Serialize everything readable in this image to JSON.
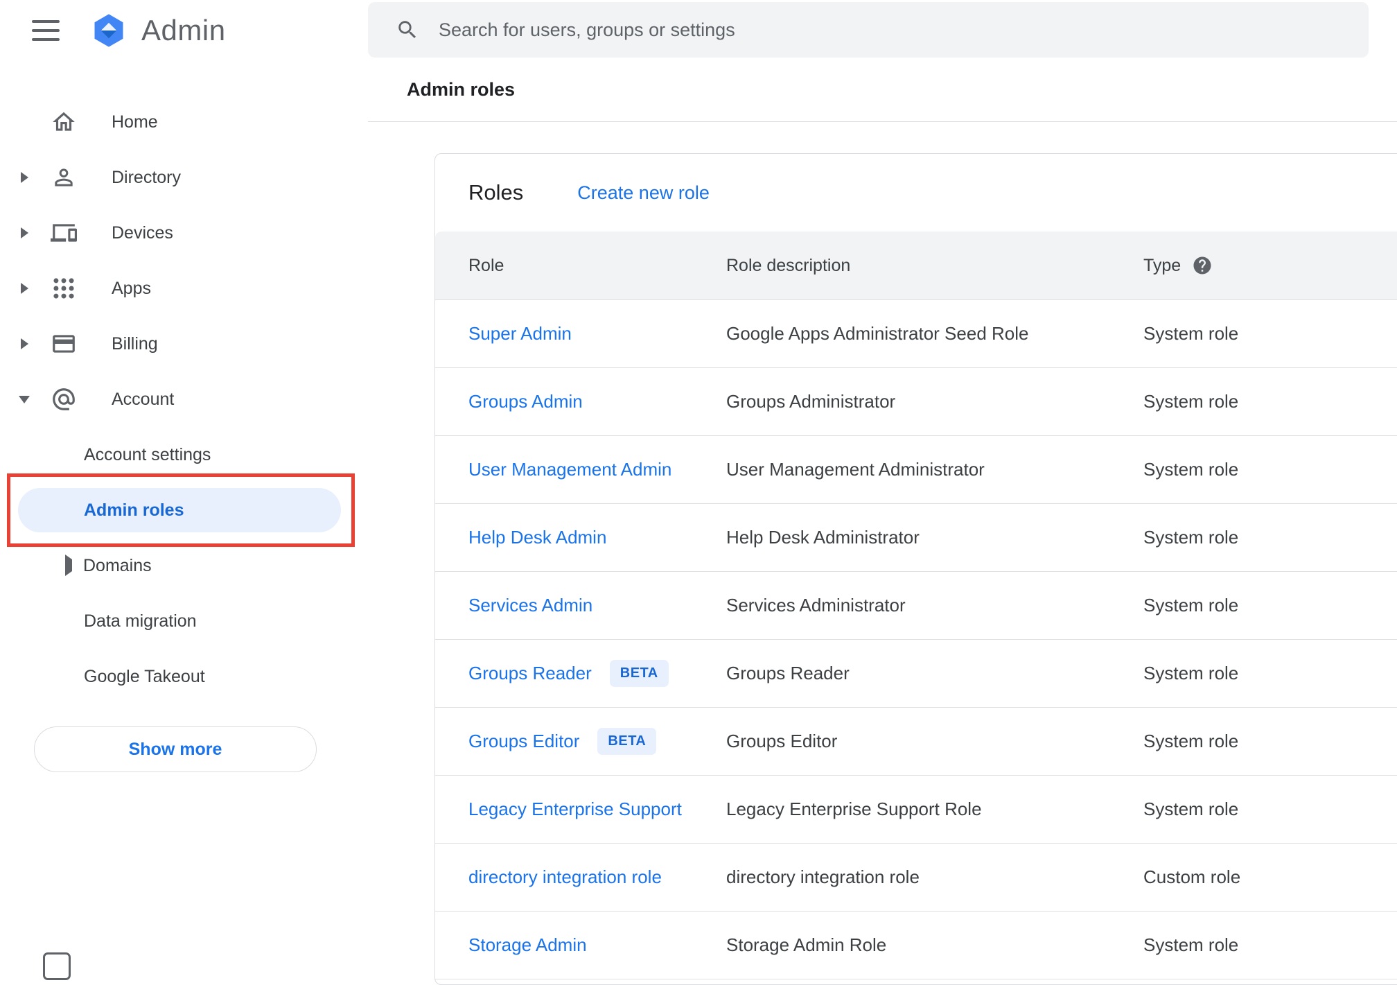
{
  "brand": {
    "name": "Admin"
  },
  "search": {
    "placeholder": "Search for users, groups or settings"
  },
  "page": {
    "title": "Admin roles"
  },
  "sidebar": {
    "items": [
      {
        "label": "Home"
      },
      {
        "label": "Directory"
      },
      {
        "label": "Devices"
      },
      {
        "label": "Apps"
      },
      {
        "label": "Billing"
      },
      {
        "label": "Account"
      }
    ],
    "account_children": {
      "settings": "Account settings",
      "admin_roles": "Admin roles",
      "domains": "Domains",
      "data_migration": "Data migration",
      "takeout": "Google Takeout"
    },
    "show_more_label": "Show more"
  },
  "roles": {
    "heading": "Roles",
    "create_link": "Create new role",
    "beta_label": "BETA",
    "columns": [
      "Role",
      "Role description",
      "Type"
    ],
    "rows": [
      {
        "role": "Super Admin",
        "beta": false,
        "description": "Google Apps Administrator Seed Role",
        "type": "System role"
      },
      {
        "role": "Groups Admin",
        "beta": false,
        "description": "Groups Administrator",
        "type": "System role"
      },
      {
        "role": "User Management Admin",
        "beta": false,
        "description": "User Management Administrator",
        "type": "System role"
      },
      {
        "role": "Help Desk Admin",
        "beta": false,
        "description": "Help Desk Administrator",
        "type": "System role"
      },
      {
        "role": "Services Admin",
        "beta": false,
        "description": "Services Administrator",
        "type": "System role"
      },
      {
        "role": "Groups Reader",
        "beta": true,
        "description": "Groups Reader",
        "type": "System role"
      },
      {
        "role": "Groups Editor",
        "beta": true,
        "description": "Groups Editor",
        "type": "System role"
      },
      {
        "role": "Legacy Enterprise Support",
        "beta": false,
        "description": "Legacy Enterprise Support Role",
        "type": "System role"
      },
      {
        "role": "directory integration role",
        "beta": false,
        "description": "directory integration role",
        "type": "Custom role"
      },
      {
        "role": "Storage Admin",
        "beta": false,
        "description": "Storage Admin Role",
        "type": "System role"
      }
    ]
  },
  "colors": {
    "link_blue": "#1a73e8",
    "selected_text": "#1967d2",
    "selected_bg": "#e8f0fe",
    "annotation_red": "#e94235",
    "table_header_bg": "#f1f3f4",
    "search_bg": "#f1f3f4",
    "logo_blue": "#4285f4"
  }
}
